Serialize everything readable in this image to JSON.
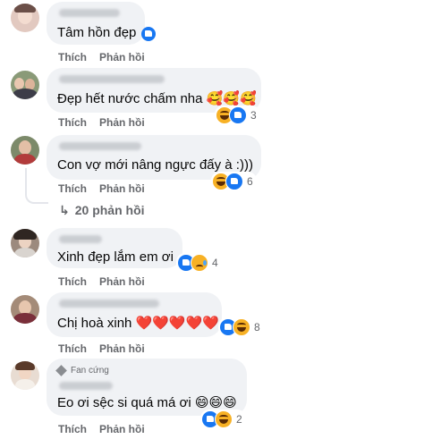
{
  "comments": [
    {
      "text": "Tâm hồn đẹp",
      "like": "Thích",
      "reply": "Phản hồi"
    },
    {
      "text": "Đẹp hết nước chấm nha 🥰🥰🥰",
      "like": "Thích",
      "reply": "Phản hồi",
      "reaction_count": "3",
      "reactions": [
        "haha",
        "like"
      ]
    },
    {
      "text": "Con vợ mới nâng ngực đấy à :)))",
      "like": "Thích",
      "reply": "Phản hồi",
      "reaction_count": "6",
      "reactions": [
        "haha",
        "like"
      ],
      "replies_link": "20 phản hồi"
    },
    {
      "text": "Xinh đẹp lắm em ơi",
      "like": "Thích",
      "reply": "Phản hồi",
      "reaction_count": "4",
      "reactions": [
        "like",
        "sad"
      ]
    },
    {
      "text": "Chị hoà xinh ❤️❤️❤️❤️❤️",
      "like": "Thích",
      "reply": "Phản hồi",
      "reaction_count": "8",
      "reactions": [
        "like",
        "haha"
      ]
    },
    {
      "badge": "Fan cứng",
      "text": "Eo ơi sệc si quá má ơi 😄😄😄",
      "like": "Thích",
      "reply": "Phản hồi",
      "reaction_count": "2",
      "reactions": [
        "like",
        "haha"
      ]
    }
  ],
  "colors": {
    "bubble": "#f0f2f5",
    "meta": "#65676b",
    "like_blue": "#1877f2",
    "reaction_yellow": "#f7b125"
  }
}
